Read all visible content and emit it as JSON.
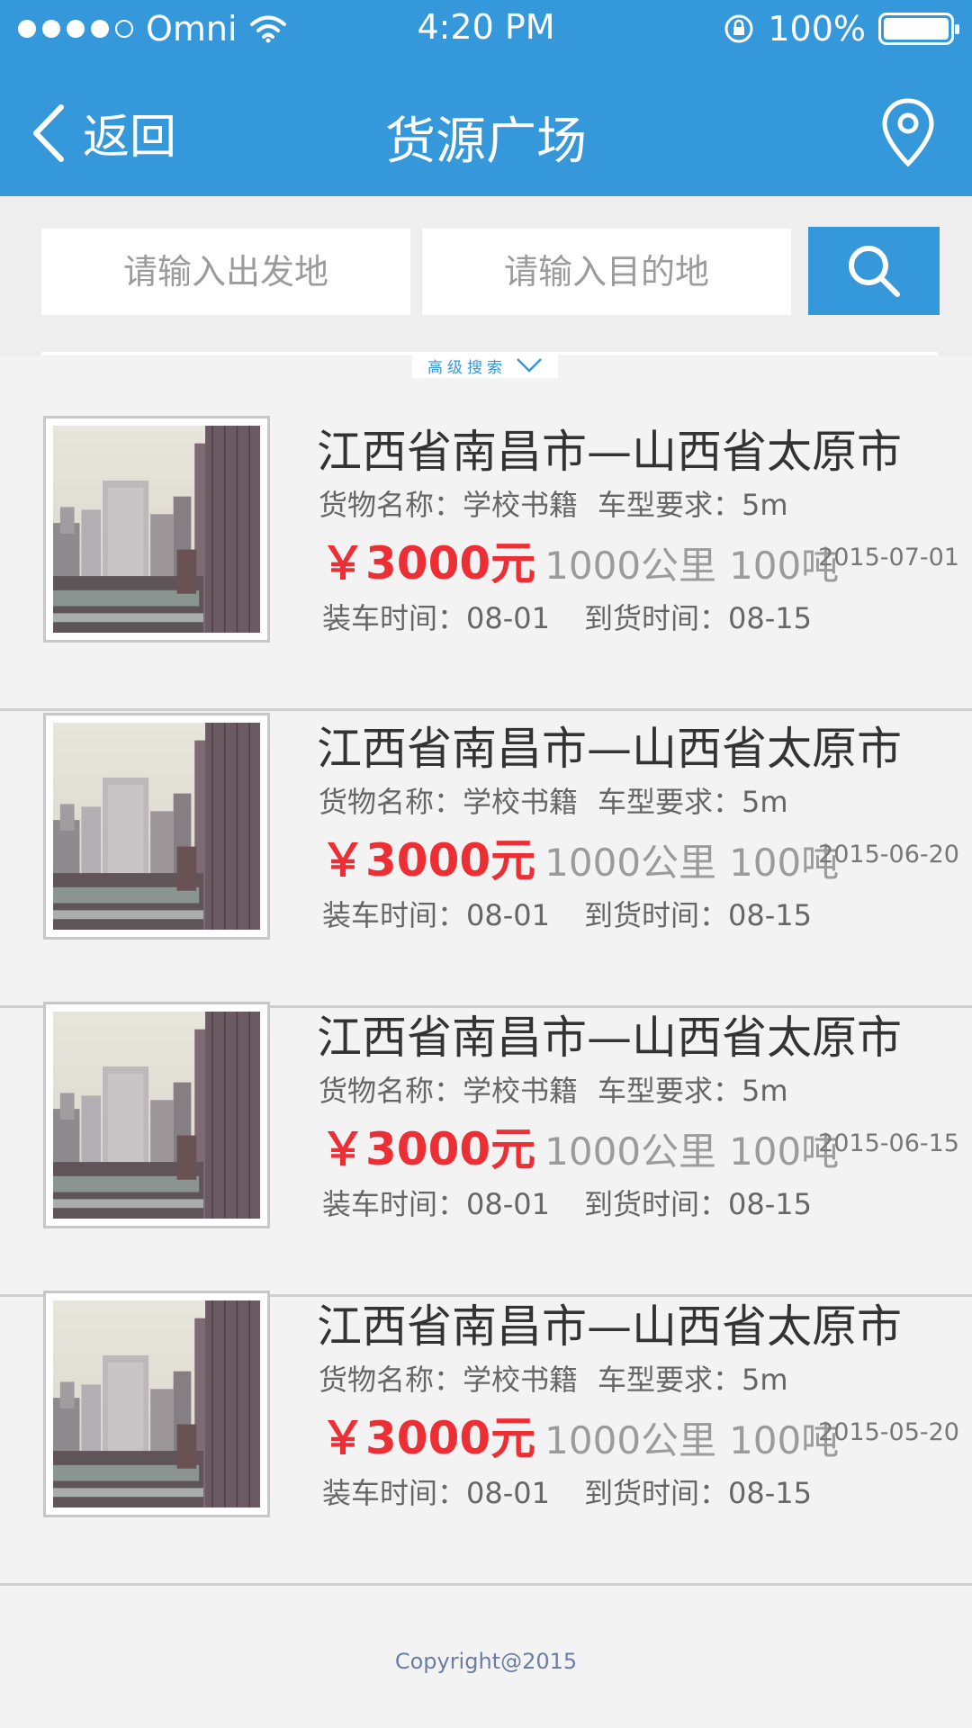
{
  "status_bar": {
    "carrier": "Omni",
    "time": "4:20 PM",
    "battery": "100%"
  },
  "nav": {
    "back_label": "返回",
    "title": "货源广场"
  },
  "search": {
    "from_placeholder": "请输入出发地",
    "to_placeholder": "请输入目的地",
    "advanced_label": "高级搜索"
  },
  "listings": [
    {
      "route": "江西省南昌市—山西省太原市",
      "goods": "货物名称：学校书籍",
      "vehicle": "车型要求：5m",
      "price": "￥3000元",
      "distance": "1000公里",
      "weight": "100吨",
      "date": "2015-07-01",
      "load_time": "装车时间：08-01",
      "arrive_time": "到货时间：08-15"
    },
    {
      "route": "江西省南昌市—山西省太原市",
      "goods": "货物名称：学校书籍",
      "vehicle": "车型要求：5m",
      "price": "￥3000元",
      "distance": "1000公里",
      "weight": "100吨",
      "date": "2015-06-20",
      "load_time": "装车时间：08-01",
      "arrive_time": "到货时间：08-15"
    },
    {
      "route": "江西省南昌市—山西省太原市",
      "goods": "货物名称：学校书籍",
      "vehicle": "车型要求：5m",
      "price": "￥3000元",
      "distance": "1000公里",
      "weight": "100吨",
      "date": "2015-06-15",
      "load_time": "装车时间：08-01",
      "arrive_time": "到货时间：08-15"
    },
    {
      "route": "江西省南昌市—山西省太原市",
      "goods": "货物名称：学校书籍",
      "vehicle": "车型要求：5m",
      "price": "￥3000元",
      "distance": "1000公里",
      "weight": "100吨",
      "date": "2015-05-20",
      "load_time": "装车时间：08-01",
      "arrive_time": "到货时间：08-15"
    }
  ],
  "footer": {
    "copyright": "Copyright@2015"
  },
  "colors": {
    "primary": "#3598db",
    "price": "#ec2f35",
    "background": "#f4f3f4"
  },
  "icons": [
    "back-chevron-icon",
    "location-pin-icon",
    "search-icon",
    "chevron-down-icon",
    "wifi-icon",
    "rotation-lock-icon",
    "battery-icon"
  ]
}
